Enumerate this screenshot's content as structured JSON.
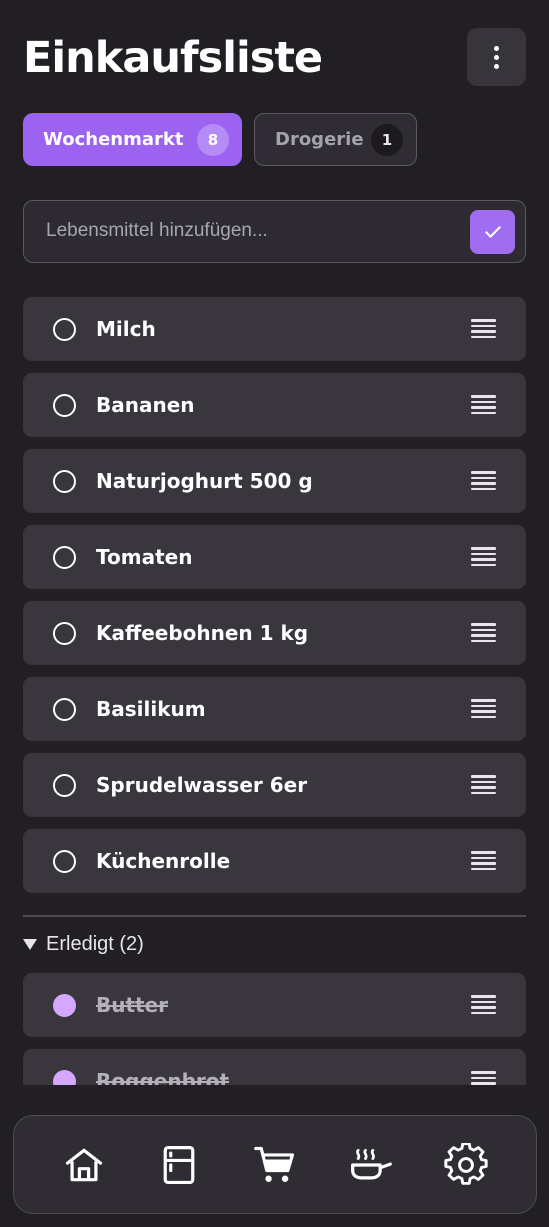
{
  "header": {
    "title": "Einkaufsliste"
  },
  "tabs": [
    {
      "label": "Wochenmarkt",
      "count": "8",
      "active": true
    },
    {
      "label": "Drogerie",
      "count": "1",
      "active": false
    }
  ],
  "add": {
    "placeholder": "Lebensmittel hinzufügen...",
    "value": ""
  },
  "items": [
    {
      "name": "Milch"
    },
    {
      "name": "Bananen"
    },
    {
      "name": "Naturjoghurt 500 g"
    },
    {
      "name": "Tomaten"
    },
    {
      "name": "Kaffeebohnen 1 kg"
    },
    {
      "name": "Basilikum"
    },
    {
      "name": "Sprudelwasser 6er"
    },
    {
      "name": "Küchenrolle"
    }
  ],
  "done_section": {
    "label": "Erledigt (2)"
  },
  "done_items": [
    {
      "name": "Butter"
    },
    {
      "name": "Roggenbrot"
    }
  ],
  "nav": [
    {
      "icon": "home-icon"
    },
    {
      "icon": "fridge-icon"
    },
    {
      "icon": "cart-icon"
    },
    {
      "icon": "cooking-pan-icon"
    },
    {
      "icon": "settings-gear-icon"
    }
  ],
  "colors": {
    "accent": "#9b63ef",
    "background": "#211f24",
    "card": "#39363d",
    "done_check": "#d5a7ff"
  }
}
